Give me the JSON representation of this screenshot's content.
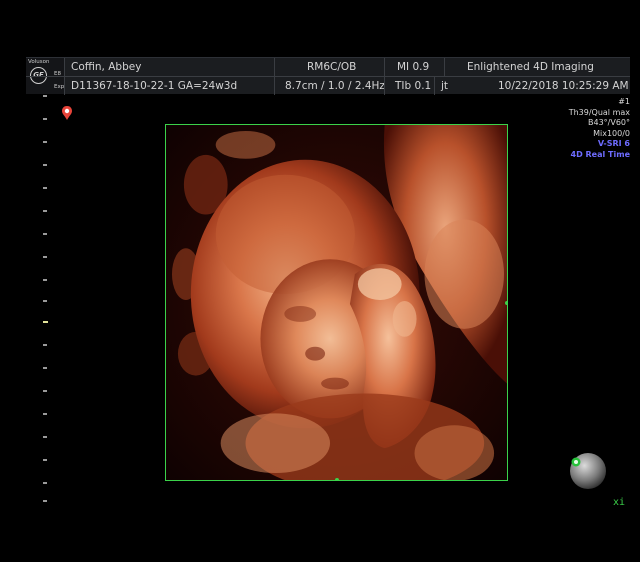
{
  "header": {
    "logo_top": "Voluson",
    "logo_mid": "E8",
    "logo_bot": "Exp",
    "ge_mark": "GE",
    "patient_name": "Coffin, Abbey",
    "probe_preset": "RM6C/OB",
    "mi": "MI  0.9",
    "site_name": "Enlightened 4D Imaging",
    "patient_id_ga": "D11367-18-10-22-1  GA=24w3d",
    "depth_freq": "8.7cm / 1.0 / 2.4Hz",
    "tib": "TIb  0.1",
    "operator": "jt",
    "datetime": "10/22/2018    10:25:29 AM"
  },
  "params": {
    "line1": "#1",
    "line2": "Th39/Qual max",
    "line3": "B43°/V60°",
    "line4": "Mix100/0",
    "line5": "V-SRI 6",
    "line6": "4D Real Time"
  },
  "bottom_right_mark": "xi",
  "colors": {
    "roi_border": "#3bd24a",
    "render_tone": "#c0502c",
    "accent_blue": "#6e6cff",
    "header_bg": "#1b1d20"
  },
  "icons": {
    "probe_marker": "probe-orientation-icon",
    "orientation": "orientation-sphere-icon"
  }
}
